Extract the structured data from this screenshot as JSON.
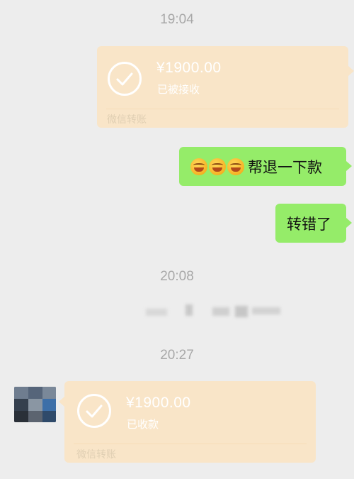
{
  "times": [
    "19:04",
    "20:08",
    "20:27"
  ],
  "transfer_1": {
    "amount": "¥1900.00",
    "status": "已被接收",
    "footer": "微信转账"
  },
  "messages": [
    {
      "text": "帮退一下款",
      "emoji_count": 3,
      "emoji_icon": "crying-laughing-emoji"
    },
    {
      "text": "转错了"
    }
  ],
  "transfer_2": {
    "amount": "¥1900.00",
    "status": "已收款",
    "footer": "微信转账"
  },
  "colors": {
    "background": "#ededed",
    "transfer_card": "#f9e5c8",
    "sent_bubble": "#95ec69",
    "timestamp": "#a8a8a8"
  }
}
